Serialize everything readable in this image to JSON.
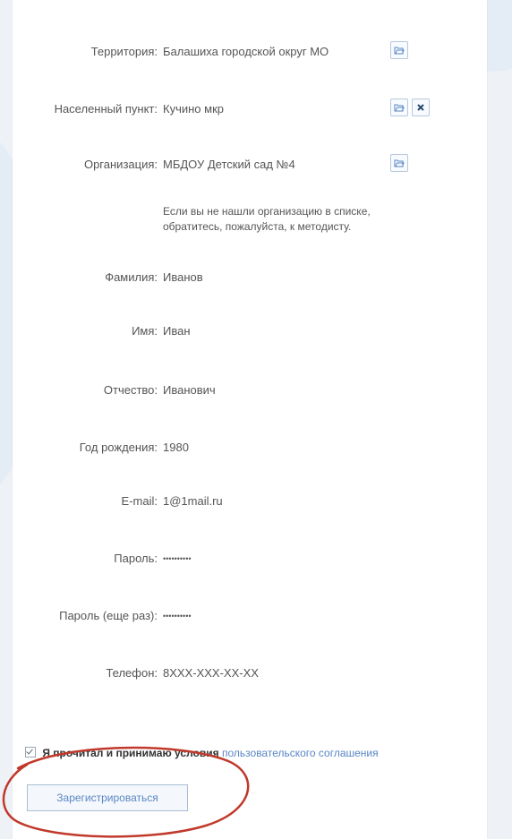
{
  "form": {
    "fields": [
      {
        "label": "Территория:",
        "value": "Балашиха городской округ МО"
      },
      {
        "label": "Населенный пункт:",
        "value": "Кучино мкр"
      },
      {
        "label": "Организация:",
        "value": "МБДОУ Детский сад №4"
      },
      {
        "label": "Фамилия:",
        "value": "Иванов"
      },
      {
        "label": "Имя:",
        "value": "Иван"
      },
      {
        "label": "Отчество:",
        "value": "Иванович"
      },
      {
        "label": "Год рождения:",
        "value": "1980"
      },
      {
        "label": "E-mail:",
        "value": "1@1mail.ru"
      },
      {
        "label": "Пароль:",
        "value": "••••••••••"
      },
      {
        "label": "Пароль (еще раз):",
        "value": "••••••••••"
      },
      {
        "label": "Телефон:",
        "value": "8XXX-XXX-XX-XX"
      }
    ],
    "note_line1": "Если вы не нашли организацию в списке,",
    "note_line2": "обратитесь, пожалуйста, к методисту.",
    "agree_text": "Я прочитал и принимаю условия",
    "agree_link": "пользовательского соглашения",
    "submit_label": "Зарегистрироваться"
  },
  "icons": {
    "select": "folder-open-icon",
    "clear": "close-icon"
  },
  "colors": {
    "accent": "#5a86c4",
    "annotation": "#c0392b"
  }
}
